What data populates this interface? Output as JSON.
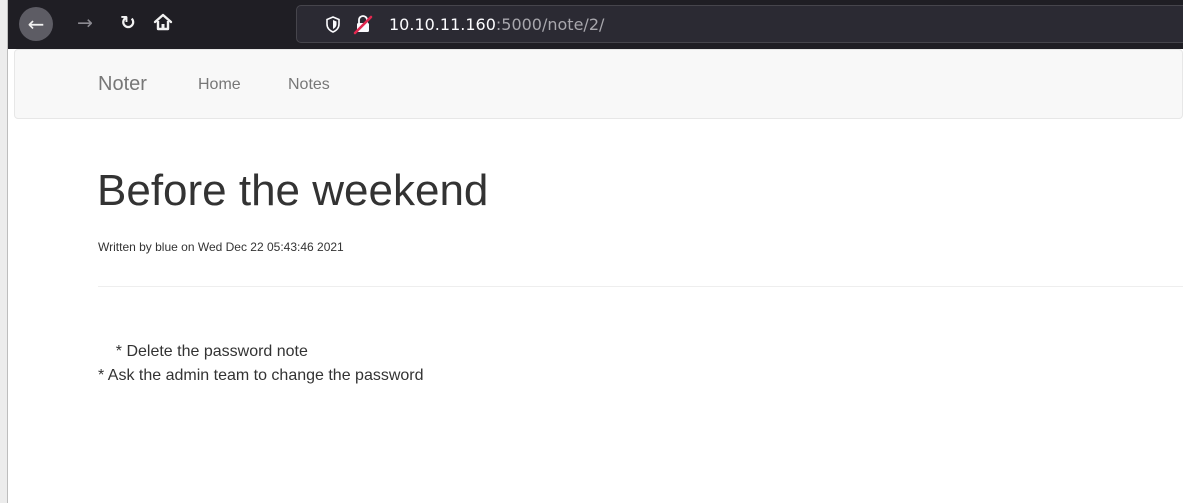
{
  "browser": {
    "url_host": "10.10.11.160",
    "url_rest": ":5000/note/2/",
    "icons": {
      "back": "back-arrow-icon",
      "forward": "forward-arrow-icon",
      "reload": "reload-icon",
      "home": "home-icon",
      "tracking": "shield-icon",
      "security": "insecure-lock-icon"
    },
    "colors": {
      "chrome_bg": "#1f1e24",
      "urlbar_bg": "#2b2a33",
      "insecure_red": "#e22850"
    }
  },
  "navbar": {
    "brand": "Noter",
    "links": [
      "Home",
      "Notes"
    ]
  },
  "note": {
    "title": "Before the weekend",
    "meta": "Written by blue on Wed Dec 22 05:43:46 2021",
    "body_lines": [
      "    * Delete the password note",
      "* Ask the admin team to change the password"
    ]
  }
}
